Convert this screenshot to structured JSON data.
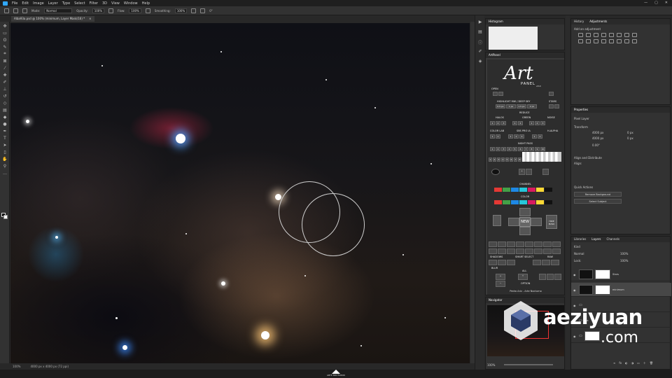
{
  "menubar": {
    "items": [
      "File",
      "Edit",
      "Image",
      "Layer",
      "Type",
      "Select",
      "Filter",
      "3D",
      "View",
      "Window",
      "Help"
    ],
    "window_controls": [
      "—",
      "▢",
      "✕"
    ]
  },
  "options_bar": {
    "mode_label": "Mode:",
    "mode_value": "Normal",
    "opacity_label": "Opacity:",
    "opacity_value": "100%",
    "flow_label": "Flow:",
    "flow_value": "100%",
    "smoothing_label": "Smoothing:",
    "smoothing_value": "100%",
    "angle_value": "0°"
  },
  "document": {
    "tab_title": "Alba93a.psd @ 100% (minimum, Layer Mask/16) *",
    "tab_close": "×",
    "status_zoom": "100%",
    "status_info": "4000 px x 4000 px (72 ppi)"
  },
  "panels": {
    "histogram_title": "Histogram",
    "artpanel_title": "ArtPanel",
    "navigator_title": "Navigator",
    "navigator_zoom": "100%",
    "history_tab": "History",
    "adjustments_tab": "Adjustments",
    "adjustments_hint": "Add an adjustment",
    "properties_title": "Properties",
    "properties_type": "Pixel Layer",
    "transform_label": "Transform",
    "transform_w": "4000 px",
    "transform_h": "4000 px",
    "transform_x": "0 px",
    "transform_y": "0 px",
    "transform_angle": "0.00°",
    "align_label": "Align and Distribute",
    "align_sub": "Align:",
    "quick_actions_label": "Quick Actions",
    "remove_bg": "Remove Background",
    "select_subject": "Select Subject",
    "libraries_tab": "Libraries",
    "layers_tab": "Layers",
    "channels_tab": "Channels",
    "layer_filter": "Kind",
    "blend_mode": "Normal",
    "opacity": "100%",
    "fill": "100%",
    "lock_label": "Lock:",
    "layer_names": [
      "Stars",
      "minimum",
      "Sta",
      ""
    ]
  },
  "artpanel": {
    "logo": "Art",
    "logo_sub": "PANEL",
    "version": "v3.0",
    "open_label": "OPEN",
    "highlight_label": "HIGHLIGHT MW / DEEP SKY",
    "highlight_values": [
      "0.5 px",
      "1 px",
      "1.5 px",
      "2 px"
    ],
    "stars_label": "STARS",
    "reduce_label": "REDUCE",
    "halos_label": "HALOS",
    "green_label": "GREEN",
    "noise_label": "NOISE",
    "color_lab_label": "COLOR LAB",
    "sbs_label": "SBS PRO IA",
    "h_alpha_label": "H-ALPHA",
    "night_pass_label": "NIGHT PASS",
    "mask_label": "MASK",
    "channel_label": "CHANNEL",
    "color_label": "COLOR",
    "new_label": "NEW",
    "hide_mask_label": "HIDE MASK",
    "all_label": "ALL",
    "shadows_label": "SHADOWS",
    "smart_select_label": "SMART SELECT",
    "raw_label": "RAW",
    "blur_label": "BLUR",
    "options_label": "OPTION",
    "footer": "Pedro Ariz - Arte Nocturno",
    "channel_colors": [
      "#e53935",
      "#43a047",
      "#1e88e5",
      "#26c6da",
      "#d81b60",
      "#fdd835",
      "#111111"
    ],
    "color_colors": [
      "#e53935",
      "#43a047",
      "#1e88e5",
      "#26c6da",
      "#d81b60",
      "#fdd835",
      "#111111"
    ]
  },
  "watermark": {
    "line1": "aeziyuan",
    "line2": ".com"
  },
  "bottom_logo": {
    "text": "ARTE NOCTURNO"
  }
}
